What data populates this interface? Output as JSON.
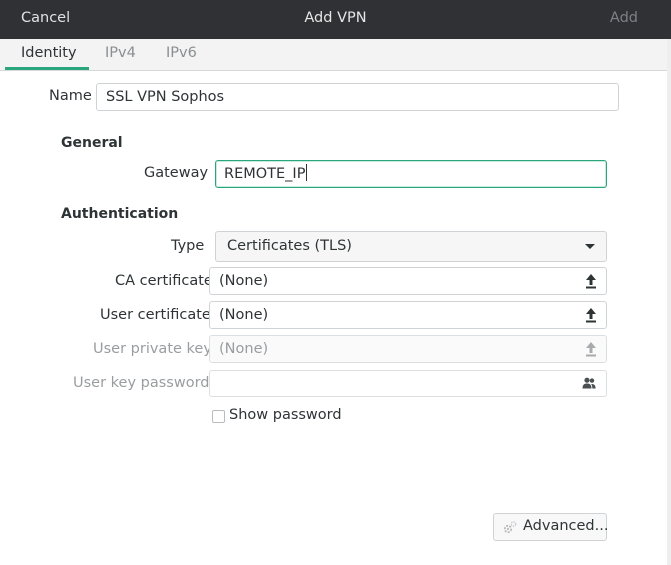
{
  "header": {
    "cancel_label": "Cancel",
    "title": "Add VPN",
    "add_label": "Add"
  },
  "tabs": [
    {
      "label": "Identity",
      "active": true
    },
    {
      "label": "IPv4",
      "active": false
    },
    {
      "label": "IPv6",
      "active": false
    }
  ],
  "identity": {
    "name_label": "Name",
    "name_value": "SSL VPN Sophos"
  },
  "general": {
    "heading": "General",
    "gateway_label": "Gateway",
    "gateway_value": "REMOTE_IP"
  },
  "authentication": {
    "heading": "Authentication",
    "type_label": "Type",
    "type_value": "Certificates (TLS)",
    "ca_cert_label": "CA certificate",
    "ca_cert_value": "(None)",
    "user_cert_label": "User certificate",
    "user_cert_value": "(None)",
    "private_key_label": "User private key",
    "private_key_value": "(None)",
    "key_password_label": "User key password",
    "key_password_value": "",
    "show_password_label": "Show password",
    "show_password_checked": false
  },
  "advanced_label": "Advanced...",
  "colors": {
    "headerbar_bg": "#2f3135",
    "accent": "#2aa67e"
  },
  "icons": {
    "upload": "upload-arrow-icon",
    "people": "people-icon",
    "gear": "gear-icon",
    "dropdown": "chevron-down-icon"
  }
}
